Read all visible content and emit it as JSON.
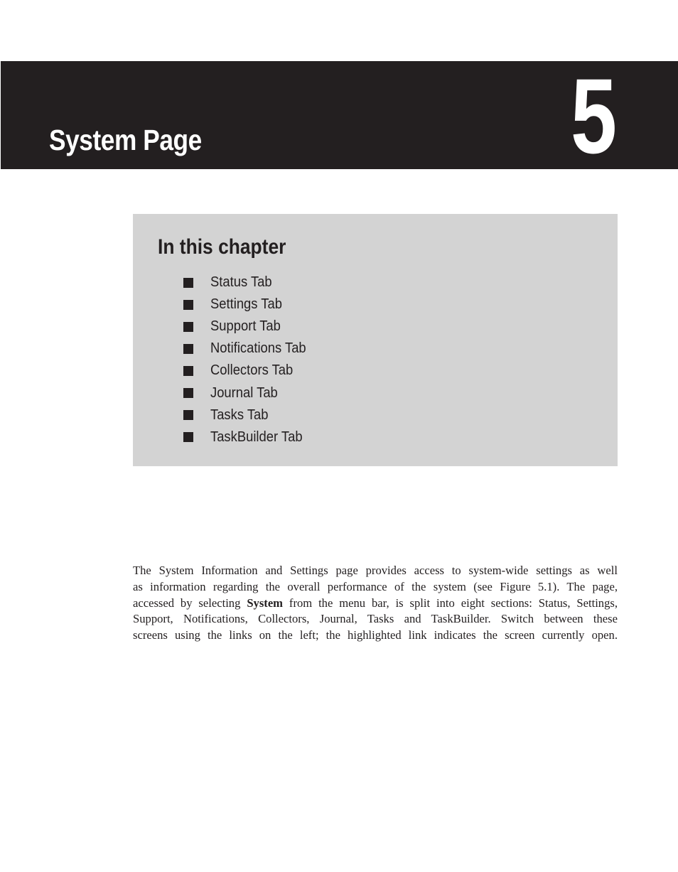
{
  "chapter": {
    "title": "System Page",
    "number": "5"
  },
  "sidebar_box": {
    "heading": "In this chapter",
    "items": [
      "Status Tab",
      "Settings Tab",
      "Support Tab",
      "Notifications Tab",
      "Collectors Tab",
      "Journal Tab",
      "Tasks Tab",
      "TaskBuilder Tab"
    ]
  },
  "body": {
    "lines": [
      "The System Information and Settings page provides access to system-wide settings as well",
      "as information regarding the overall performance of the system (see Figure 5.1). The page,",
      "from the menu bar, is split into eight sections: Status, Settings,",
      "Support, Notifications, Collectors, Journal, Tasks and TaskBuilder. Switch between these",
      "screens using the links on the left; the highlighted link indicates the screen currently open."
    ],
    "line3_prefix": "accessed by selecting ",
    "line3_bold": "System",
    "line3_suffix_space": " "
  }
}
